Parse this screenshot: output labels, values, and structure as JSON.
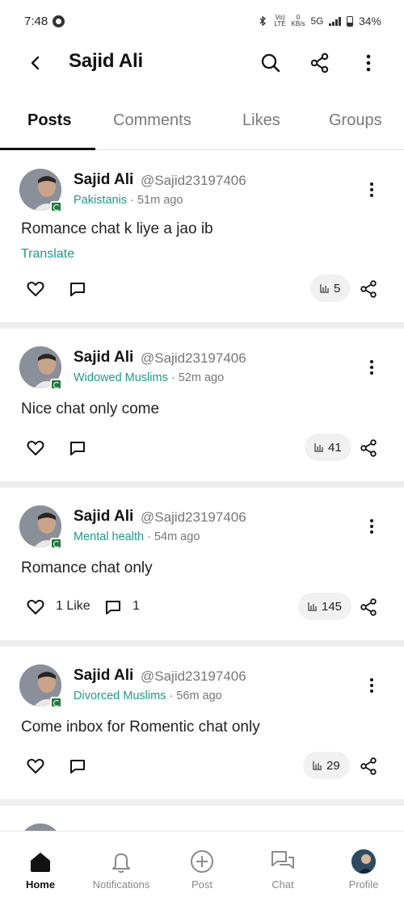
{
  "status_bar": {
    "time": "7:48",
    "network_small_top": "Vo) LTE",
    "speed_top": "0",
    "speed_unit": "KB/s",
    "network_type": "5G",
    "battery": "34%"
  },
  "header": {
    "title": "Sajid Ali"
  },
  "tabs": [
    {
      "label": "Posts",
      "active": true
    },
    {
      "label": "Comments",
      "active": false
    },
    {
      "label": "Likes",
      "active": false
    },
    {
      "label": "Groups",
      "active": false
    }
  ],
  "posts": [
    {
      "name": "Sajid Ali",
      "handle": "@Sajid23197406",
      "group": "Pakistanis",
      "time": "· 51m ago",
      "text": "Romance chat k liye a jao ib",
      "translate": "Translate",
      "views": "5"
    },
    {
      "name": "Sajid Ali",
      "handle": "@Sajid23197406",
      "group": "Widowed Muslims",
      "time": "· 52m ago",
      "text": "Nice chat only come",
      "views": "41"
    },
    {
      "name": "Sajid Ali",
      "handle": "@Sajid23197406",
      "group": "Mental health",
      "time": "· 54m ago",
      "text": "Romance chat only",
      "likes_label": "1 Like",
      "comments_count": "1",
      "views": "145"
    },
    {
      "name": "Sajid Ali",
      "handle": "@Sajid23197406",
      "group": "Divorced Muslims",
      "time": "· 56m ago",
      "text": "Come inbox for Romentic chat only",
      "views": "29"
    }
  ],
  "bottom_nav": [
    {
      "label": "Home",
      "icon": "home-icon",
      "active": true
    },
    {
      "label": "Notifications",
      "icon": "bell-icon",
      "active": false
    },
    {
      "label": "Post",
      "icon": "plus-circle-icon",
      "active": false
    },
    {
      "label": "Chat",
      "icon": "chat-bubbles-icon",
      "active": false
    },
    {
      "label": "Profile",
      "icon": "profile-avatar",
      "active": false
    }
  ],
  "colors": {
    "accent": "#1e9a8c",
    "text": "#111111",
    "muted": "#777777",
    "separator": "#eeeeee"
  }
}
